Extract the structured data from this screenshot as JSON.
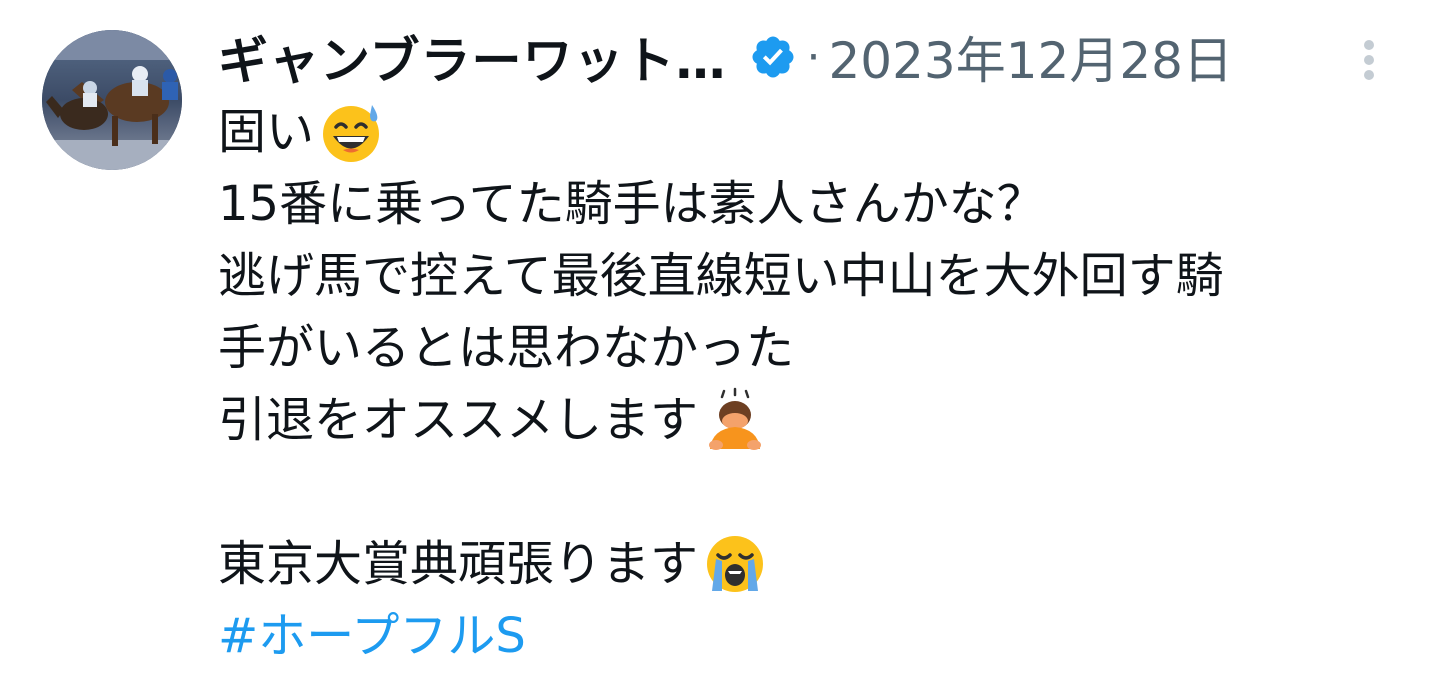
{
  "author": {
    "display_name": "ギャンブラーワット…",
    "verified_icon": "verified-badge-icon",
    "avatar_icon": "horse-racing-avatar"
  },
  "meta": {
    "separator": "·",
    "timestamp": "2023年12月28日",
    "more_icon": "more-vertical-icon"
  },
  "tweet": {
    "line1": "固い",
    "line1_emoji": "grinning-sweat-emoji",
    "line2": "15番に乗ってた騎手は素人さんかな？",
    "line3": "逃げ馬で控えて最後直線短い中山を大外回す騎",
    "line4": "手がいるとは思わなかった",
    "line5": "引退をオススメします",
    "line5_emoji": "person-bowing-emoji",
    "line6": "東京大賞典頑張ります",
    "line6_emoji": "loudly-crying-emoji",
    "hashtag": "#ホープフルS"
  },
  "colors": {
    "text": "#0f1419",
    "muted": "#536471",
    "link": "#1d9bf0",
    "verified": "#1d9bf0"
  }
}
